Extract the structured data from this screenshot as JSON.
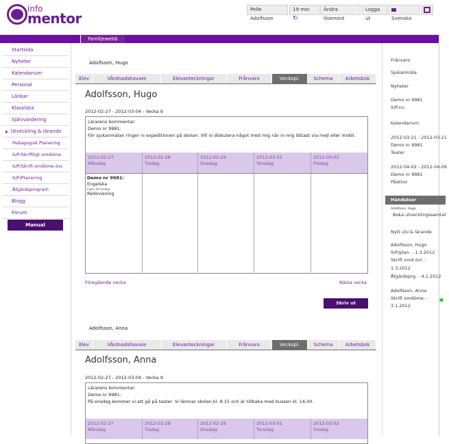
{
  "header": {
    "logo_info": "info",
    "logo_mentor": "mentor",
    "user": "Pelle Adolfsson",
    "timer": "19 min",
    "change_password": "Ändra lösenord",
    "logout": "Logga ut",
    "language": "Svenska",
    "tab_familj": "Familjewebb"
  },
  "nav": {
    "items": [
      {
        "label": "Startsida"
      },
      {
        "label": "Nyheter"
      },
      {
        "label": "Kalendarium"
      },
      {
        "label": "Personal"
      },
      {
        "label": "Länkar"
      },
      {
        "label": "Klasslista"
      },
      {
        "label": "Självvärdering"
      },
      {
        "label": "Utveckling & lärande"
      },
      {
        "label": "Pedagogisk Planering"
      },
      {
        "label": "IUP/Skriftligt omdöme"
      },
      {
        "label": "IUP/Skrift omdöme övr"
      },
      {
        "label": "IUP/Planering"
      },
      {
        "label": "Åtgärdsprogram"
      },
      {
        "label": "Blogg"
      },
      {
        "label": "Forum"
      }
    ],
    "manual": "Manual"
  },
  "tabs": [
    "Elev",
    "Vårdnadshavare",
    "Elevanteckningar",
    "Frånvaro",
    "Veckopl.",
    "Schema",
    "Arbetsbok"
  ],
  "students": [
    {
      "head": "Adolfsson, Hugo",
      "name": "Adolfsson, Hugo",
      "week": "2012-02-27 - 2012-03-04 - Vecka 9",
      "comment_head": "Lärarens kommentar:",
      "comment_sub": "Demo nr 9981:",
      "comment_text": "För sjukanmälan ringer ni expeditionen på skolan. Vill ni diskutera något med mig når ni mig lättast via mejl eller mobil.",
      "days": [
        {
          "date": "2012-02-27",
          "day": "Måndag"
        },
        {
          "date": "2012-02-28",
          "day": "Tisdag"
        },
        {
          "date": "2012-02-29",
          "day": "Onsdag"
        },
        {
          "date": "2012-03-01",
          "day": "Torsdag"
        },
        {
          "date": "2012-03-02",
          "day": "Fredag"
        }
      ],
      "monday_cell": {
        "title": "Demo nr 9981:",
        "subject": "Engelska",
        "note": "Ingen förmiddag",
        "task": "Redovisning"
      },
      "prev_week": "Föregående vecka",
      "next_week": "Nästa vecka",
      "print": "Skriv ut"
    },
    {
      "head": "Adolfsson, Anna",
      "name": "Adolfsson, Anna",
      "week": "2012-02-27 - 2012-03-04 - Vecka 9",
      "comment_head": "Lärarens kommentar:",
      "comment_sub": "Demo nr 9981:",
      "comment_text": "På onsdag kommer vi att gå på teater. Vi lämnar skolan kl. 8.15 och är tillbaka med bussen kl. 14.00.",
      "days": [
        {
          "date": "2012-02-27",
          "day": "Måndag"
        },
        {
          "date": "2012-02-28",
          "day": "Tisdag"
        },
        {
          "date": "2012-02-29",
          "day": "Onsdag"
        },
        {
          "date": "2012-03-01",
          "day": "Torsdag"
        },
        {
          "date": "2012-03-02",
          "day": "Fredag"
        }
      ]
    }
  ],
  "right": {
    "franvaro": "Frånvaro",
    "sjukanmala": "Sjukanmäla",
    "nyheter": "Nyheter",
    "demo": "Demo nr 9981",
    "iup": "IUP.nu",
    "kalendarium": "Kalendarium",
    "cal1_dates": "2012-03-21 - 2012-03-21",
    "cal1_demo": "Demo nr 9981",
    "cal1_link": "Teater",
    "cal2_dates": "2012-04-02 - 2012-04-06",
    "cal2_demo": "Demo nr 9981",
    "cal2_link": "Påsklov",
    "handelser": "Händelser",
    "hand_small": "Adolfsson, Hugo",
    "hand_link": "Boka utvecklingssamtal",
    "nytt": "Nytt utv.& lärande",
    "h_name": "Adolfsson, Hugo",
    "h1": "IUP/plan. - 1.3.2012",
    "h2": "Skrift omd övr. -",
    "h2b": "1.3.2012",
    "h3": "Åtgärdsprg. - 4.1.2012",
    "a_name": "Adolfsson, Anna",
    "a1": "Skrift omdöme. -",
    "a1b": "3.1.2012"
  }
}
